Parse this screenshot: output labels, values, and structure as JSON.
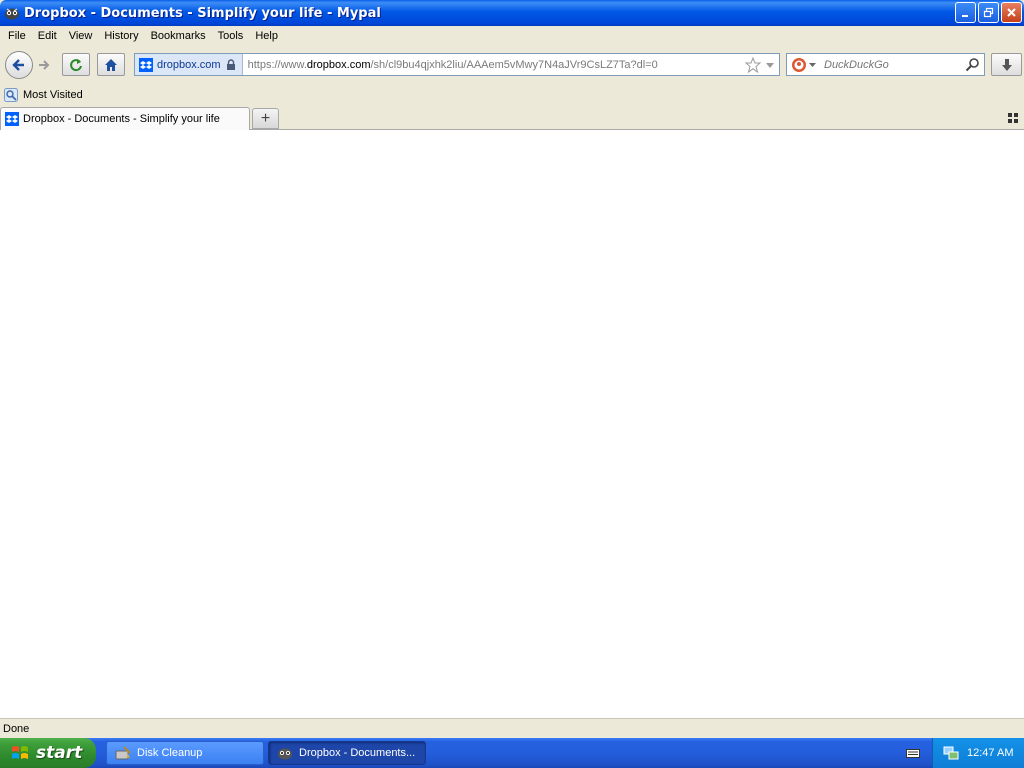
{
  "window": {
    "title": "Dropbox - Documents - Simplify your life - Mypal"
  },
  "menu": {
    "items": [
      "File",
      "Edit",
      "View",
      "History",
      "Bookmarks",
      "Tools",
      "Help"
    ]
  },
  "navbar": {
    "site_identity": "dropbox.com",
    "url_prefix": "https://www.",
    "url_domain": "dropbox.com",
    "url_path": "/sh/cl9bu4qjxhk2liu/AAAem5vMwy7N4aJVr9CsLZ7Ta?dl=0",
    "search_placeholder": "DuckDuckGo"
  },
  "bookmarks": {
    "items": [
      {
        "label": "Most Visited"
      }
    ]
  },
  "tabs": [
    {
      "label": "Dropbox - Documents - Simplify your life",
      "active": true
    }
  ],
  "status": {
    "text": "Done"
  },
  "taskbar": {
    "start_label": "start",
    "tasks": [
      {
        "label": "Disk Cleanup",
        "active": false
      },
      {
        "label": "Dropbox - Documents...",
        "active": true
      }
    ],
    "clock": "12:47 AM"
  },
  "colors": {
    "dropbox_blue": "#0061fe",
    "titlebar_blue": "#0058e6",
    "start_green": "#3d9e3a"
  }
}
